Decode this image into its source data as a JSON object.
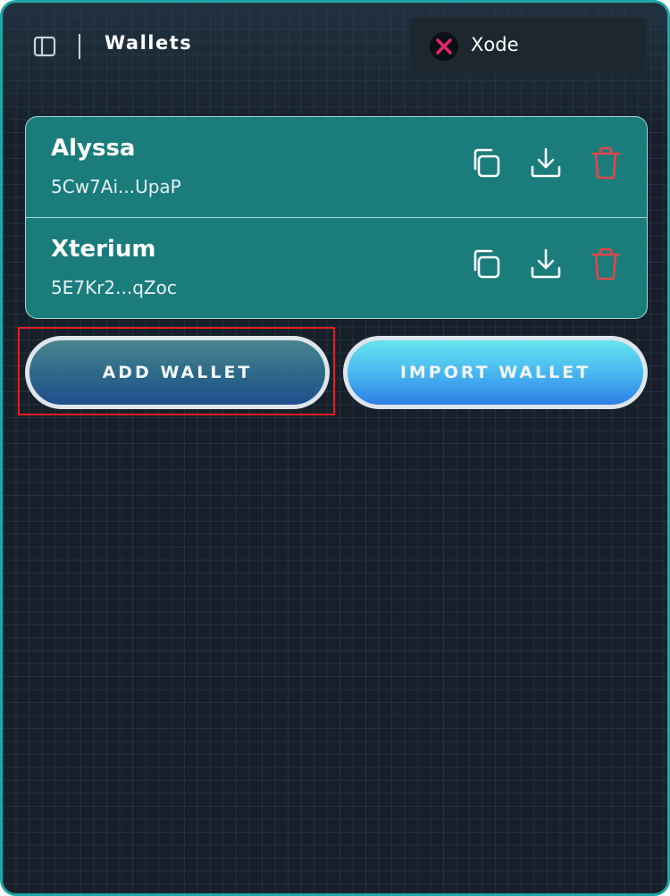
{
  "header": {
    "title": "Wallets"
  },
  "network": {
    "name": "Xode",
    "icon": "xode-logo-icon"
  },
  "wallets": [
    {
      "name": "Alyssa",
      "address": "5Cw7Ai...UpaP"
    },
    {
      "name": "Xterium",
      "address": "5E7Kr2...qZoc"
    }
  ],
  "actions": {
    "add_label": "ADD WALLET",
    "import_label": "IMPORT WALLET"
  },
  "colors": {
    "frame_border": "#1aa8a6",
    "background": "#17202a",
    "wallet_card": "#1b7c7c",
    "delete_red": "#e0474a",
    "highlight": "#e0201f"
  }
}
